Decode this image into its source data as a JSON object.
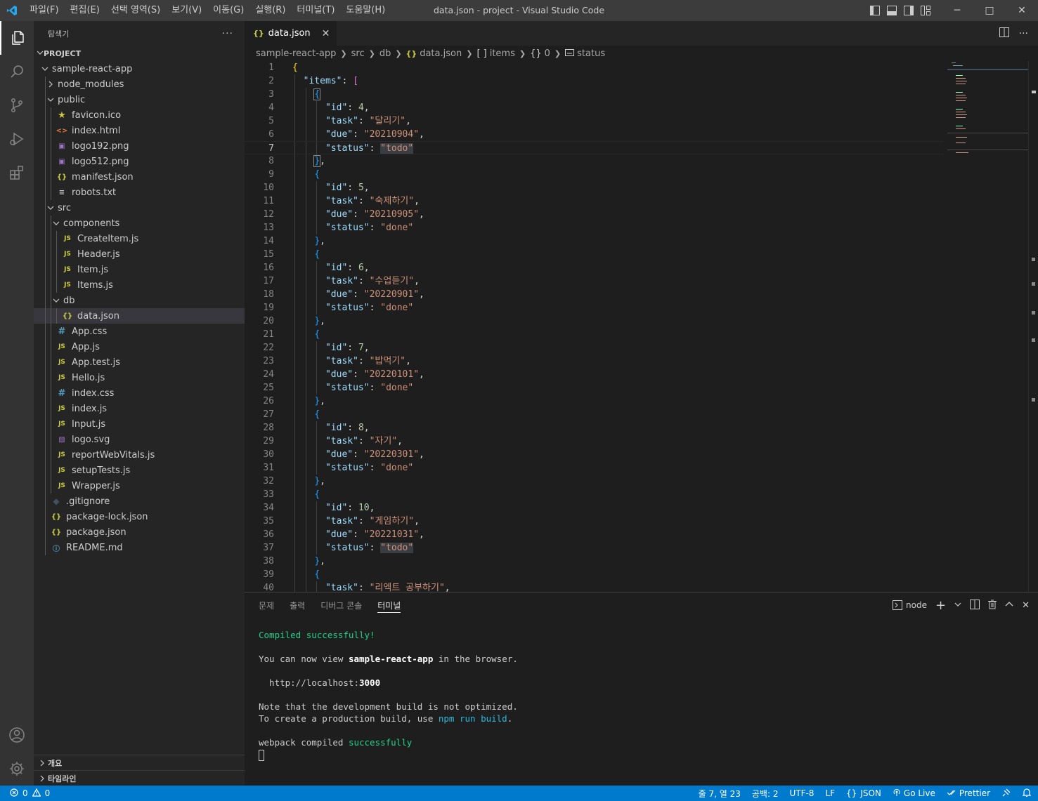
{
  "window": {
    "title": "data.json - project - Visual Studio Code",
    "menus": [
      "파일(F)",
      "편집(E)",
      "선택 영역(S)",
      "보기(V)",
      "이동(G)",
      "실행(R)",
      "터미널(T)",
      "도움말(H)"
    ]
  },
  "activity_bar": {
    "items": [
      "explorer-icon",
      "search-icon",
      "source-control-icon",
      "run-debug-icon",
      "extensions-icon"
    ],
    "bottom": [
      "account-icon",
      "settings-gear-icon"
    ],
    "active": "explorer-icon"
  },
  "sidebar": {
    "title": "탐색기",
    "more": "···",
    "section": "PROJECT",
    "tree": [
      {
        "label": "sample-react-app",
        "depth": 1,
        "type": "folder-open",
        "icon": "chevron-down-icon"
      },
      {
        "label": "node_modules",
        "depth": 2,
        "type": "folder-closed",
        "icon": "chevron-right-icon"
      },
      {
        "label": "public",
        "depth": 2,
        "type": "folder-open",
        "icon": "chevron-down-icon"
      },
      {
        "label": "favicon.ico",
        "depth": 3,
        "type": "file",
        "icon": "star-icon"
      },
      {
        "label": "index.html",
        "depth": 3,
        "type": "file",
        "icon": "html-icon"
      },
      {
        "label": "logo192.png",
        "depth": 3,
        "type": "file",
        "icon": "image-icon"
      },
      {
        "label": "logo512.png",
        "depth": 3,
        "type": "file",
        "icon": "image-icon"
      },
      {
        "label": "manifest.json",
        "depth": 3,
        "type": "file",
        "icon": "json-icon"
      },
      {
        "label": "robots.txt",
        "depth": 3,
        "type": "file",
        "icon": "text-icon"
      },
      {
        "label": "src",
        "depth": 2,
        "type": "folder-open",
        "icon": "chevron-down-icon"
      },
      {
        "label": "components",
        "depth": 3,
        "type": "folder-open",
        "icon": "chevron-down-icon"
      },
      {
        "label": "CreateItem.js",
        "depth": 4,
        "type": "file",
        "icon": "js-icon"
      },
      {
        "label": "Header.js",
        "depth": 4,
        "type": "file",
        "icon": "js-icon"
      },
      {
        "label": "Item.js",
        "depth": 4,
        "type": "file",
        "icon": "js-icon"
      },
      {
        "label": "Items.js",
        "depth": 4,
        "type": "file",
        "icon": "js-icon"
      },
      {
        "label": "db",
        "depth": 3,
        "type": "folder-open",
        "icon": "chevron-down-icon"
      },
      {
        "label": "data.json",
        "depth": 4,
        "type": "file",
        "icon": "json-icon",
        "selected": true
      },
      {
        "label": "App.css",
        "depth": 3,
        "type": "file",
        "icon": "css-icon"
      },
      {
        "label": "App.js",
        "depth": 3,
        "type": "file",
        "icon": "js-icon"
      },
      {
        "label": "App.test.js",
        "depth": 3,
        "type": "file",
        "icon": "js-icon"
      },
      {
        "label": "Hello.js",
        "depth": 3,
        "type": "file",
        "icon": "js-icon"
      },
      {
        "label": "index.css",
        "depth": 3,
        "type": "file",
        "icon": "css-icon"
      },
      {
        "label": "index.js",
        "depth": 3,
        "type": "file",
        "icon": "js-icon"
      },
      {
        "label": "Input.js",
        "depth": 3,
        "type": "file",
        "icon": "js-icon"
      },
      {
        "label": "logo.svg",
        "depth": 3,
        "type": "file",
        "icon": "svg-icon"
      },
      {
        "label": "reportWebVitals.js",
        "depth": 3,
        "type": "file",
        "icon": "js-icon"
      },
      {
        "label": "setupTests.js",
        "depth": 3,
        "type": "file",
        "icon": "js-icon"
      },
      {
        "label": "Wrapper.js",
        "depth": 3,
        "type": "file",
        "icon": "js-icon"
      },
      {
        "label": ".gitignore",
        "depth": 2,
        "type": "file",
        "icon": "git-icon"
      },
      {
        "label": "package-lock.json",
        "depth": 2,
        "type": "file",
        "icon": "json-icon"
      },
      {
        "label": "package.json",
        "depth": 2,
        "type": "file",
        "icon": "json-icon"
      },
      {
        "label": "README.md",
        "depth": 2,
        "type": "file",
        "icon": "info-icon"
      }
    ],
    "bottom_sections": [
      "개요",
      "타임라인"
    ]
  },
  "editor": {
    "tab": {
      "icon": "{}",
      "label": "data.json",
      "close": "✕"
    },
    "breadcrumb": [
      "sample-react-app",
      "src",
      "db",
      "data.json",
      "items",
      "0",
      "status"
    ],
    "current_line": 7,
    "lines": [
      {
        "n": "1",
        "code": "{"
      },
      {
        "n": "2",
        "code": "  \"items\": ["
      },
      {
        "n": "3",
        "code": "    {"
      },
      {
        "n": "4",
        "code": "      \"id\": 4,"
      },
      {
        "n": "5",
        "code": "      \"task\": \"달리기\","
      },
      {
        "n": "6",
        "code": "      \"due\": \"20210904\","
      },
      {
        "n": "7",
        "code": "      \"status\": \"todo\""
      },
      {
        "n": "8",
        "code": "    },"
      },
      {
        "n": "9",
        "code": "    {"
      },
      {
        "n": "10",
        "code": "      \"id\": 5,"
      },
      {
        "n": "11",
        "code": "      \"task\": \"숙제하기\","
      },
      {
        "n": "12",
        "code": "      \"due\": \"20210905\","
      },
      {
        "n": "13",
        "code": "      \"status\": \"done\""
      },
      {
        "n": "14",
        "code": "    },"
      },
      {
        "n": "15",
        "code": "    {"
      },
      {
        "n": "16",
        "code": "      \"id\": 6,"
      },
      {
        "n": "17",
        "code": "      \"task\": \"수업듣기\","
      },
      {
        "n": "18",
        "code": "      \"due\": \"20220901\","
      },
      {
        "n": "19",
        "code": "      \"status\": \"done\""
      },
      {
        "n": "20",
        "code": "    },"
      },
      {
        "n": "21",
        "code": "    {"
      },
      {
        "n": "22",
        "code": "      \"id\": 7,"
      },
      {
        "n": "23",
        "code": "      \"task\": \"밥먹기\","
      },
      {
        "n": "24",
        "code": "      \"due\": \"20220101\","
      },
      {
        "n": "25",
        "code": "      \"status\": \"done\""
      },
      {
        "n": "26",
        "code": "    },"
      },
      {
        "n": "27",
        "code": "    {"
      },
      {
        "n": "28",
        "code": "      \"id\": 8,"
      },
      {
        "n": "29",
        "code": "      \"task\": \"자기\","
      },
      {
        "n": "30",
        "code": "      \"due\": \"20220301\","
      },
      {
        "n": "31",
        "code": "      \"status\": \"done\""
      },
      {
        "n": "32",
        "code": "    },"
      },
      {
        "n": "33",
        "code": "    {"
      },
      {
        "n": "34",
        "code": "      \"id\": 10,"
      },
      {
        "n": "35",
        "code": "      \"task\": \"게임하기\","
      },
      {
        "n": "36",
        "code": "      \"due\": \"20221031\","
      },
      {
        "n": "37",
        "code": "      \"status\": \"todo\""
      },
      {
        "n": "38",
        "code": "    },"
      },
      {
        "n": "39",
        "code": "    {"
      },
      {
        "n": "40",
        "code": "      \"task\": \"리엑트 공부하기\","
      }
    ]
  },
  "panel": {
    "tabs": [
      "문제",
      "출력",
      "디버그 콘솔",
      "터미널"
    ],
    "active_tab": "터미널",
    "terminal_name": "node",
    "terminal": {
      "l1": "Compiled successfully!",
      "l2a": "You can now view ",
      "l2b": "sample-react-app",
      "l2c": " in the browser.",
      "l3a": "  http://localhost:",
      "l3b": "3000",
      "l4": "Note that the development build is not optimized.",
      "l5a": "To create a production build, use ",
      "l5b": "npm run build",
      "l5c": ".",
      "l6a": "webpack compiled ",
      "l6b": "successfully"
    }
  },
  "statusbar": {
    "errors": "0",
    "warnings": "0",
    "position": "줄 7, 열 23",
    "spaces": "공백: 2",
    "encoding": "UTF-8",
    "eol": "LF",
    "language": "JSON",
    "golive": "Go Live",
    "prettier": "Prettier"
  },
  "colors": {
    "titlebar": "#3c3c3c",
    "activitybar": "#333333",
    "sidebar": "#252526",
    "editor": "#1e1e1e",
    "statusbar": "#007acc"
  }
}
